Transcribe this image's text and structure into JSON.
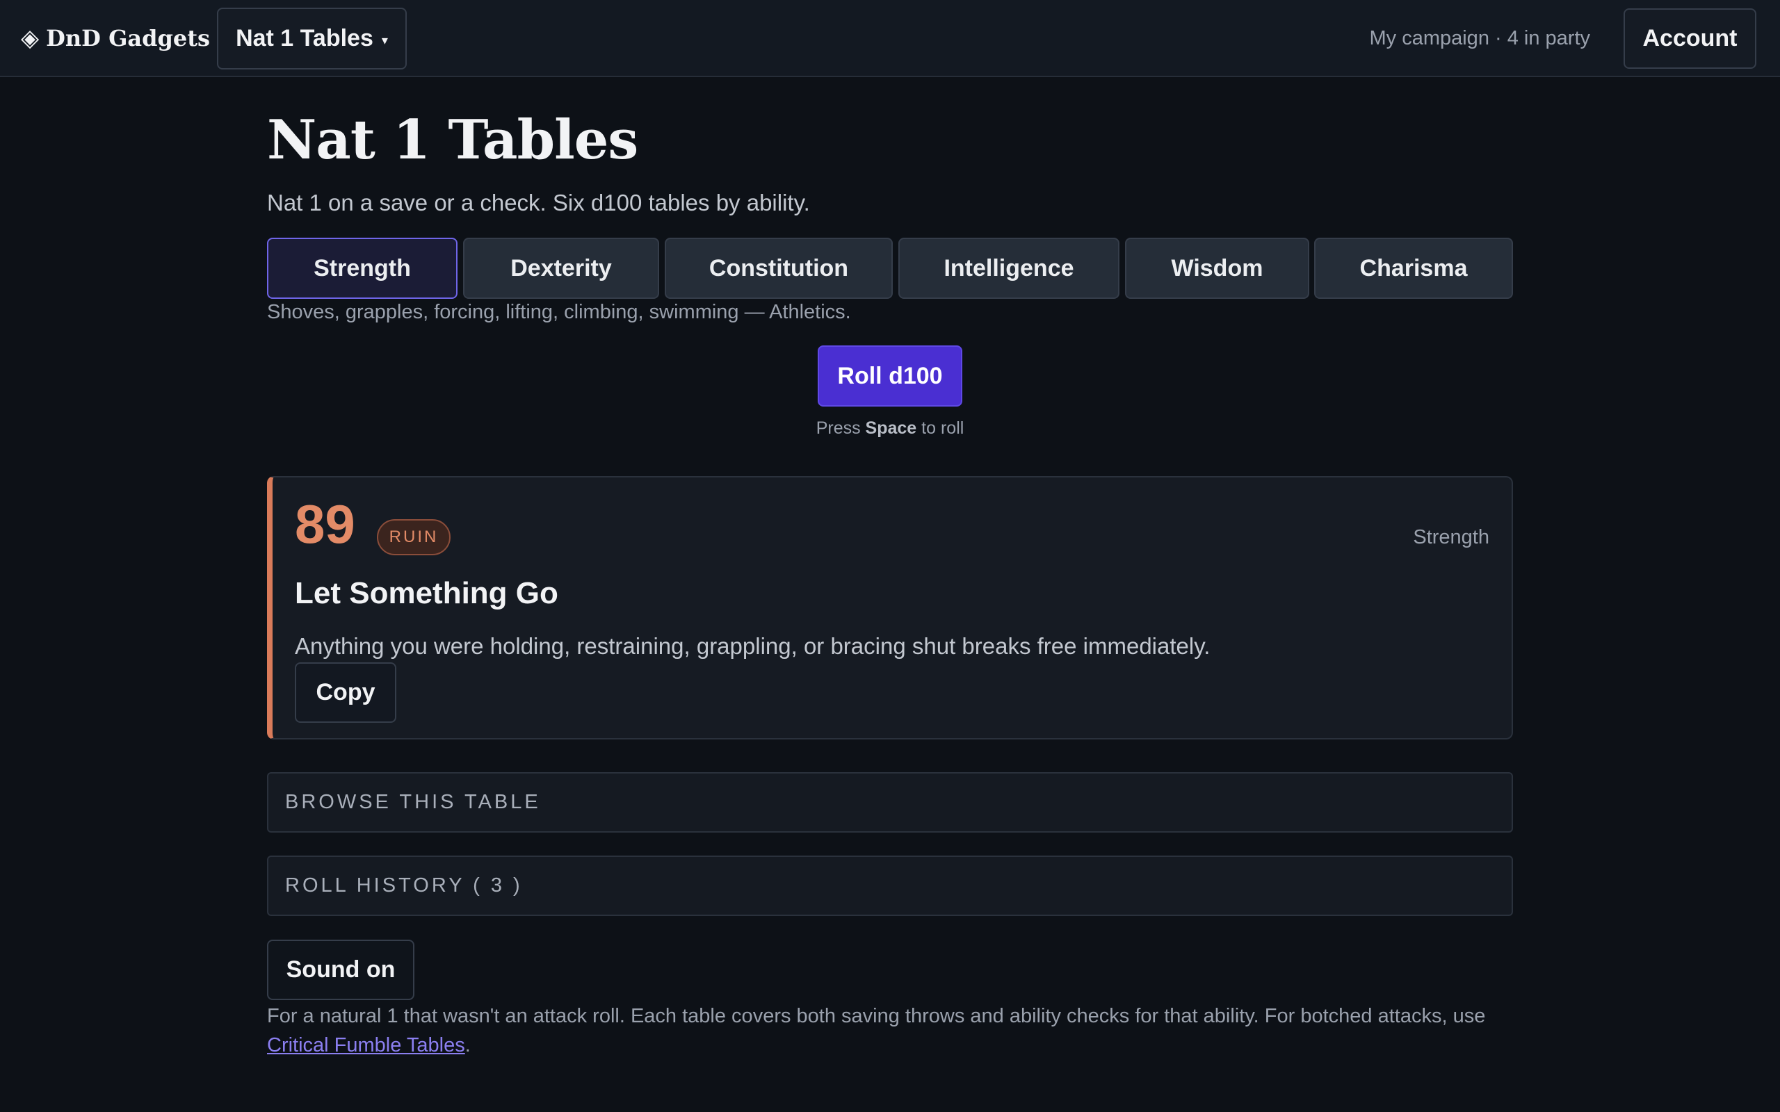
{
  "header": {
    "logo_glyph": "◈",
    "logo_text": "DnD Gadgets",
    "tool_select": "Nat 1 Tables",
    "tool_caret": "▾",
    "campaign": "My campaign · 4 in party",
    "account": "Account"
  },
  "main": {
    "title": "Nat 1 Tables",
    "subtitle": "Nat 1 on a save or a check. Six d100 tables by ability.",
    "tabs": [
      {
        "label": "Strength",
        "active": true
      },
      {
        "label": "Dexterity",
        "active": false
      },
      {
        "label": "Constitution",
        "active": false
      },
      {
        "label": "Intelligence",
        "active": false
      },
      {
        "label": "Wisdom",
        "active": false
      },
      {
        "label": "Charisma",
        "active": false
      }
    ],
    "tab_description": "Shoves, grapples, forcing, lifting, climbing, swimming — Athletics.",
    "roll_button": "Roll d100",
    "roll_hint": {
      "prefix": "Press",
      "key": "Space",
      "suffix": "to roll"
    }
  },
  "result": {
    "number": "89",
    "tier": "RUIN",
    "ability": "Strength",
    "title": "Let Something Go",
    "text": "Anything you were holding, restraining, grappling, or bracing shut breaks free immediately.",
    "copy": "Copy"
  },
  "sections": {
    "browse": "BROWSE THIS TABLE",
    "history": "ROLL HISTORY ( 3 )"
  },
  "sound": "Sound on",
  "footnote": {
    "text": "For a natural 1 that wasn't an attack roll. Each table covers both saving throws and ability checks for that ability. For botched attacks, use",
    "link": "Critical Fumble Tables",
    "suffix": "."
  },
  "colors": {
    "background": "#0d1117",
    "accent": "#4a2fd2",
    "ruin": "#e38b67",
    "link": "#8b7ff0"
  }
}
